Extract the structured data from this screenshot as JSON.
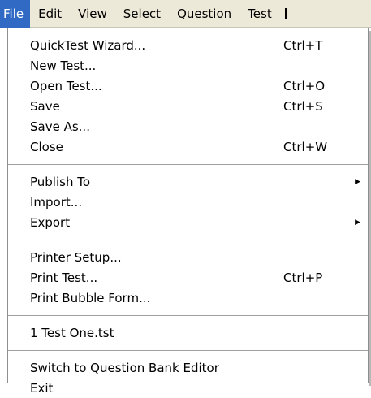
{
  "menubar": {
    "items": [
      "File",
      "Edit",
      "View",
      "Select",
      "Question",
      "Test"
    ]
  },
  "file_menu": {
    "group1": [
      {
        "label": "QuickTest Wizard...",
        "shortcut": "Ctrl+T"
      },
      {
        "label": "New Test...",
        "shortcut": ""
      },
      {
        "label": "Open Test...",
        "shortcut": "Ctrl+O"
      },
      {
        "label": "Save",
        "shortcut": "Ctrl+S"
      },
      {
        "label": "Save As...",
        "shortcut": ""
      },
      {
        "label": "Close",
        "shortcut": "Ctrl+W"
      }
    ],
    "group2": [
      {
        "label": "Publish To",
        "submenu_icon": "triangle-right-icon"
      },
      {
        "label": "Import..."
      },
      {
        "label": "Export",
        "submenu_icon": "triangle-right-icon"
      }
    ],
    "group3": [
      {
        "label": "Printer Setup...",
        "shortcut": ""
      },
      {
        "label": "Print Test...",
        "shortcut": "Ctrl+P"
      },
      {
        "label": "Print Bubble Form...",
        "shortcut": ""
      }
    ],
    "group4": [
      {
        "label": "1 Test One.tst"
      }
    ],
    "group5": [
      {
        "label": "Switch to Question Bank Editor"
      },
      {
        "label": "Exit"
      }
    ]
  }
}
